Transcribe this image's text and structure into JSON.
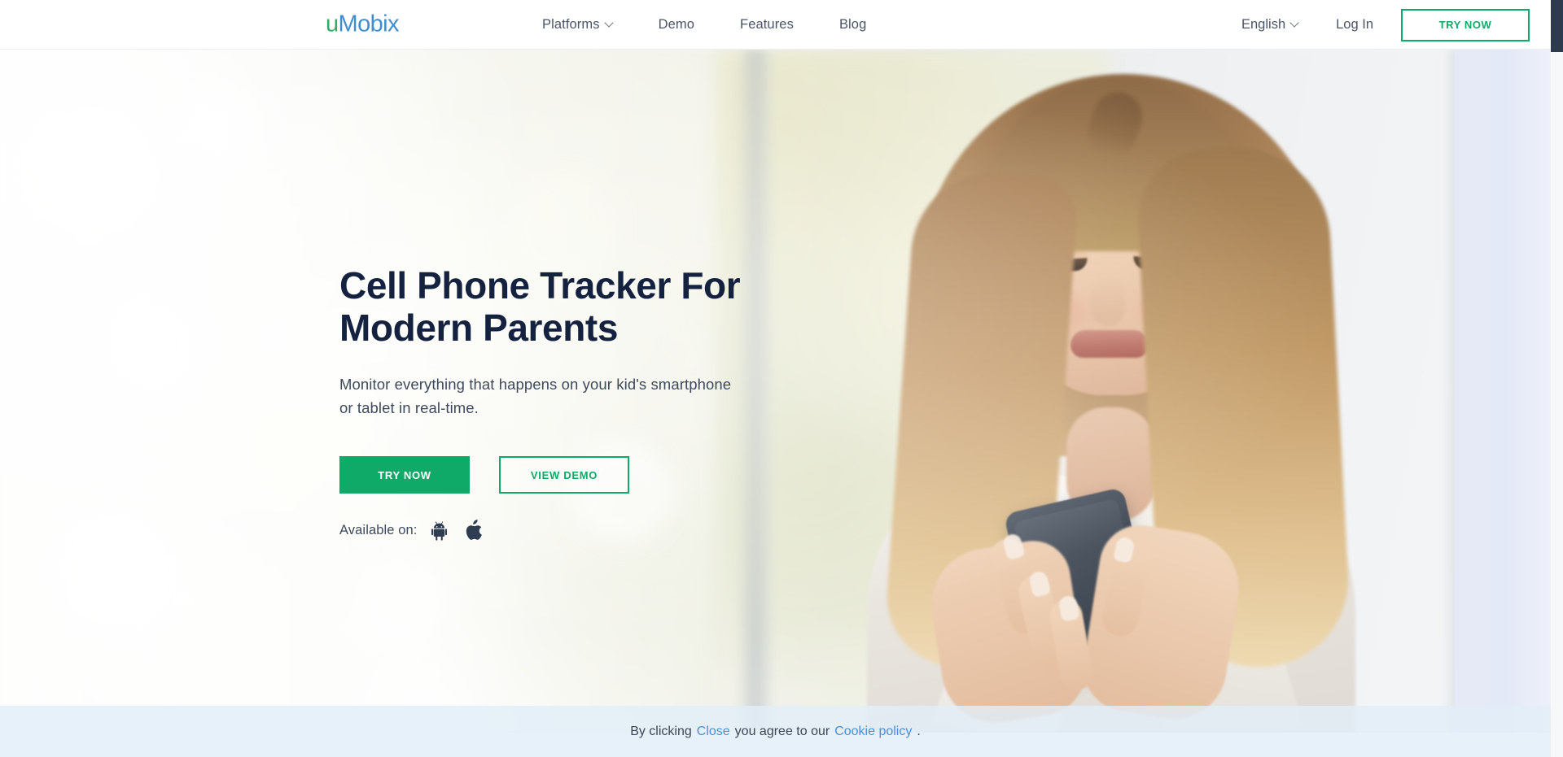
{
  "header": {
    "logo": {
      "part1": "u",
      "part2": "Mobix"
    },
    "nav": [
      {
        "label": "Platforms",
        "has_dropdown": true
      },
      {
        "label": "Demo",
        "has_dropdown": false
      },
      {
        "label": "Features",
        "has_dropdown": false
      },
      {
        "label": "Blog",
        "has_dropdown": false
      }
    ],
    "language": "English",
    "login": "Log In",
    "cta": "TRY NOW"
  },
  "hero": {
    "title": "Cell Phone Tracker For Modern Parents",
    "subtitle": "Monitor everything that happens on your kid's smartphone or tablet in real-time.",
    "primary_cta": "TRY NOW",
    "secondary_cta": "VIEW DEMO",
    "available_label": "Available on:",
    "platforms": [
      {
        "name": "android-icon"
      },
      {
        "name": "apple-icon"
      }
    ]
  },
  "cookie": {
    "prefix": "By clicking",
    "close_link": "Close",
    "middle": "you agree to our",
    "policy_link": "Cookie policy",
    "suffix": "."
  },
  "colors": {
    "brand_green": "#0fa968",
    "logo_green": "#2eae64",
    "logo_blue": "#3f8fd0",
    "heading_navy": "#14223f",
    "body_text": "#3e4a5c",
    "link_blue": "#4a90d9",
    "cookie_bg": "#e2eef8",
    "scrollbar_thumb": "#2e3b4e"
  }
}
